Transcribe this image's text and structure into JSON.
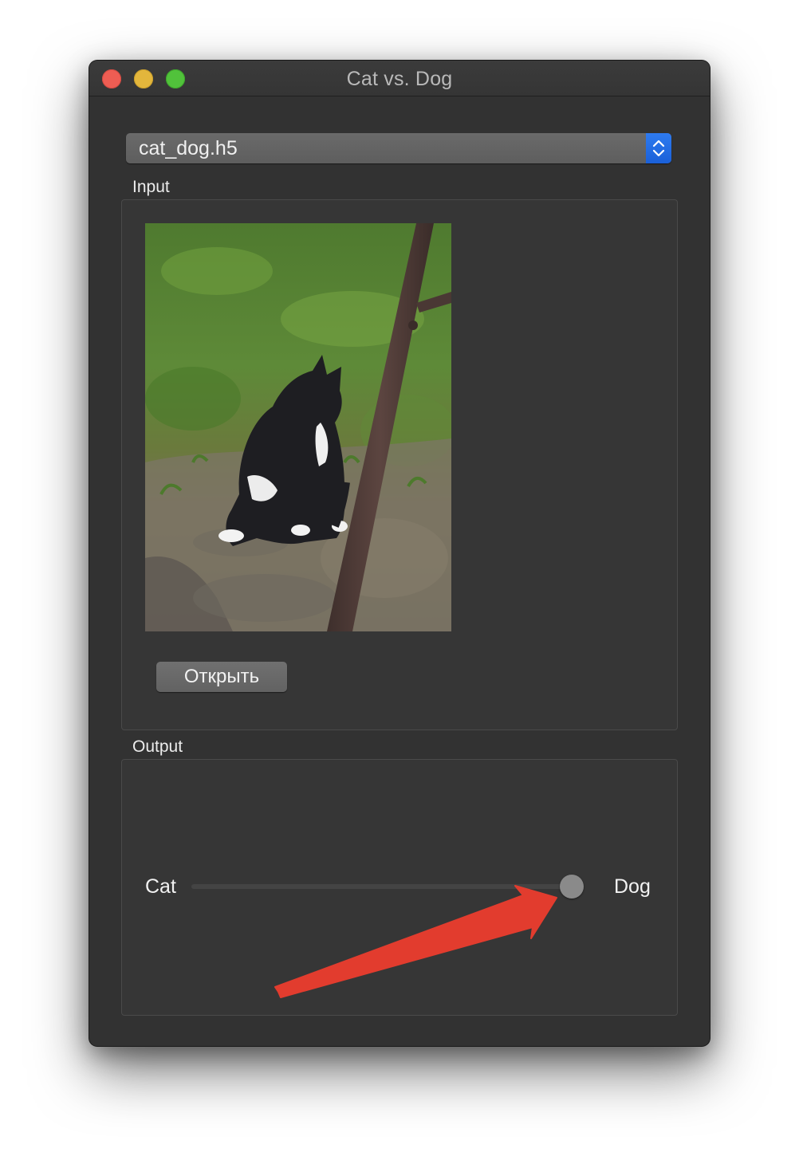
{
  "window": {
    "title": "Cat vs. Dog"
  },
  "model_select": {
    "value": "cat_dog.h5"
  },
  "input_section": {
    "label": "Input",
    "open_button_label": "Открыть"
  },
  "output_section": {
    "label": "Output",
    "slider": {
      "left_label": "Cat",
      "right_label": "Dog",
      "value_fraction": 0.97
    }
  },
  "colors": {
    "window_background": "#323232",
    "accent": "#1a60d8",
    "close": "#ee5d53",
    "minimize": "#e3b63c",
    "zoom": "#51c23b",
    "annotation_arrow": "#e23c2e"
  },
  "icons": {
    "popup_indicator": "up-down-chevrons-icon",
    "annotation": "red-arrow-annotation"
  }
}
